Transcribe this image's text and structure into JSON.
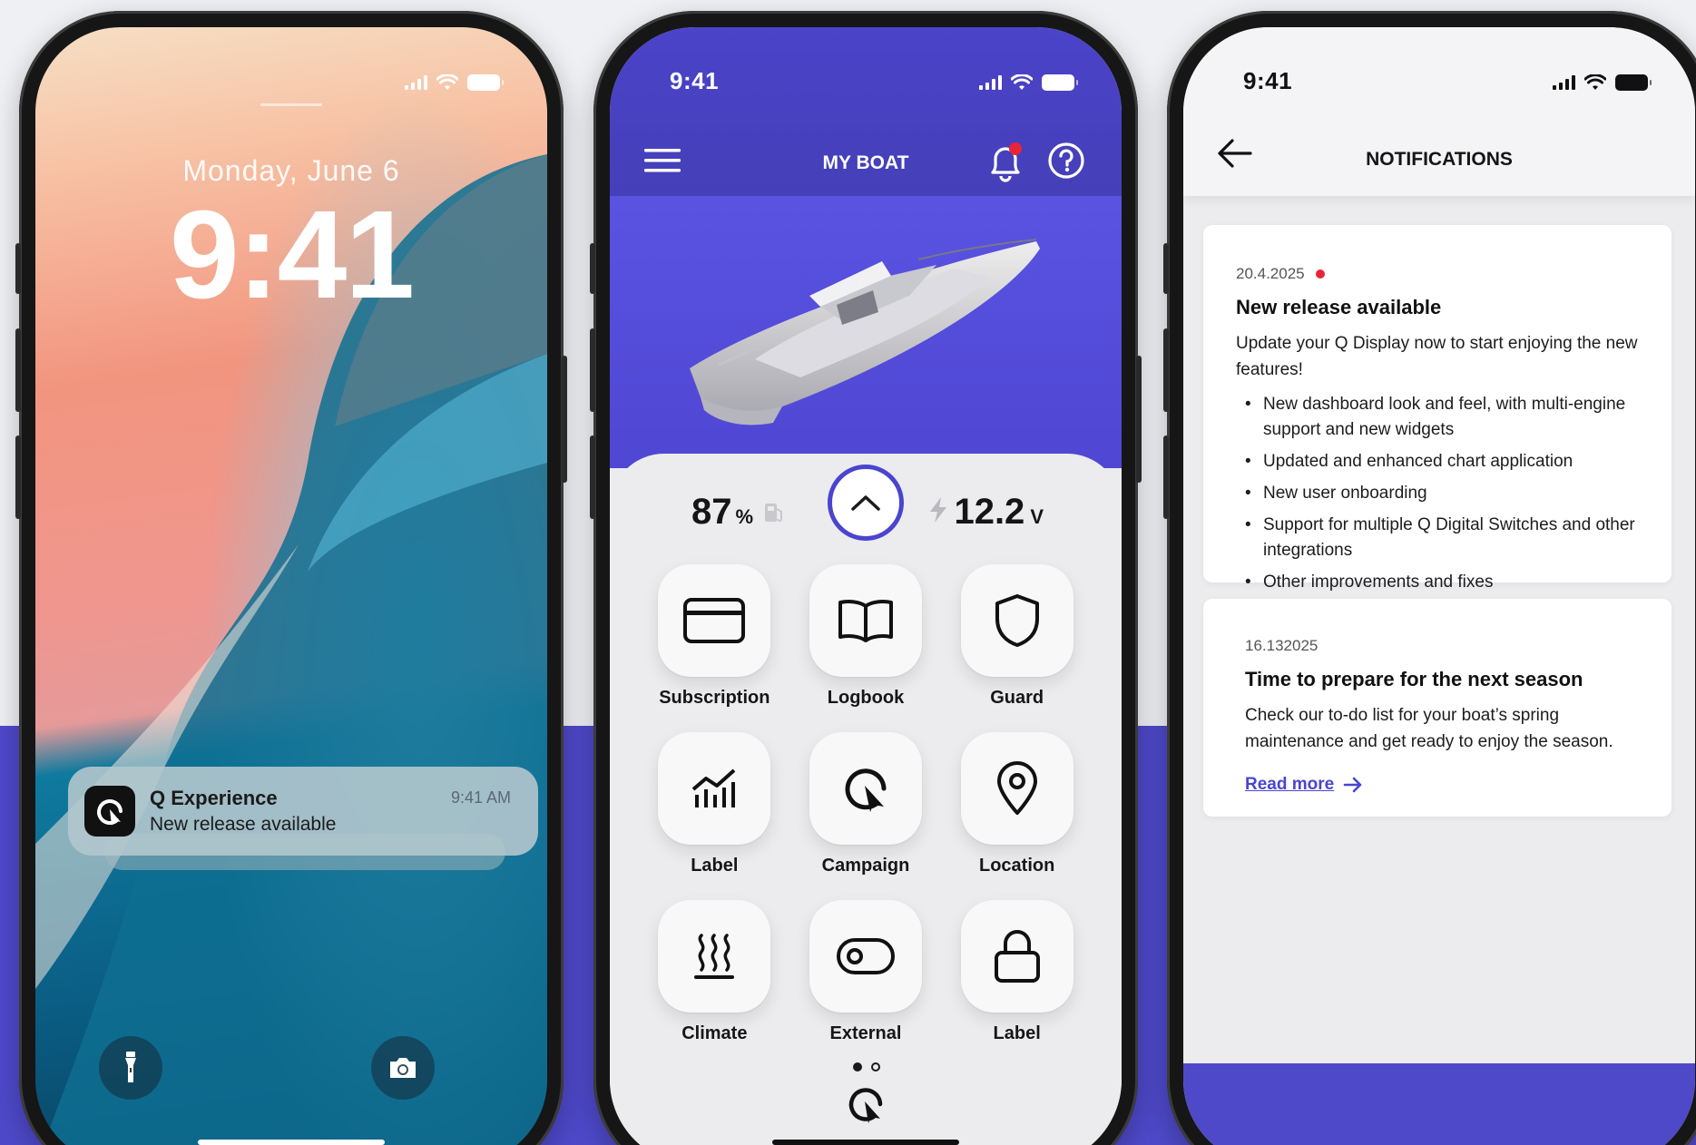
{
  "colors": {
    "accent": "#4a44d0",
    "background_band": "#4e49c9",
    "alert_dot": "#e8243a"
  },
  "lock_screen": {
    "date": "Monday, June 6",
    "time": "9:41",
    "notification": {
      "app": "Q Experience",
      "message": "New release available",
      "time": "9:41 AM",
      "icon": "q-logo-icon"
    },
    "left_button_icon": "flashlight-icon",
    "right_button_icon": "camera-icon"
  },
  "boat_screen": {
    "status_time": "9:41",
    "title": "MY BOAT",
    "fuel": {
      "value": "87",
      "unit": "%"
    },
    "voltage": {
      "value": "12.2",
      "unit": "V"
    },
    "tiles": [
      {
        "label": "Subscription",
        "icon": "card-icon"
      },
      {
        "label": "Logbook",
        "icon": "book-icon"
      },
      {
        "label": "Guard",
        "icon": "shield-icon"
      },
      {
        "label": "Label",
        "icon": "chart-icon"
      },
      {
        "label": "Campaign",
        "icon": "campaign-icon"
      },
      {
        "label": "Location",
        "icon": "location-pin-icon"
      },
      {
        "label": "Climate",
        "icon": "heat-icon"
      },
      {
        "label": "External",
        "icon": "toggle-icon"
      },
      {
        "label": "Label",
        "icon": "lock-icon"
      }
    ],
    "page_indicator": {
      "current": 1,
      "total": 2
    }
  },
  "notifications_screen": {
    "status_time": "9:41",
    "title": "NOTIFICATIONS",
    "cards": [
      {
        "date": "20.4.2025",
        "unread": true,
        "title": "New release available",
        "body": "Update your Q Display now to start enjoying the new features!",
        "bullets": [
          "New dashboard look and feel, with multi-engine support and new widgets",
          "Updated and enhanced chart application",
          "New user onboarding",
          "Support for multiple Q Digital Switches and other integrations",
          "Other improvements and fixes"
        ]
      },
      {
        "date": "16.132025",
        "unread": false,
        "title": "Time to prepare for the next season",
        "body": "Check our to-do list for your boat’s spring maintenance and get ready to enjoy the season.",
        "link": "Read more"
      }
    ]
  }
}
